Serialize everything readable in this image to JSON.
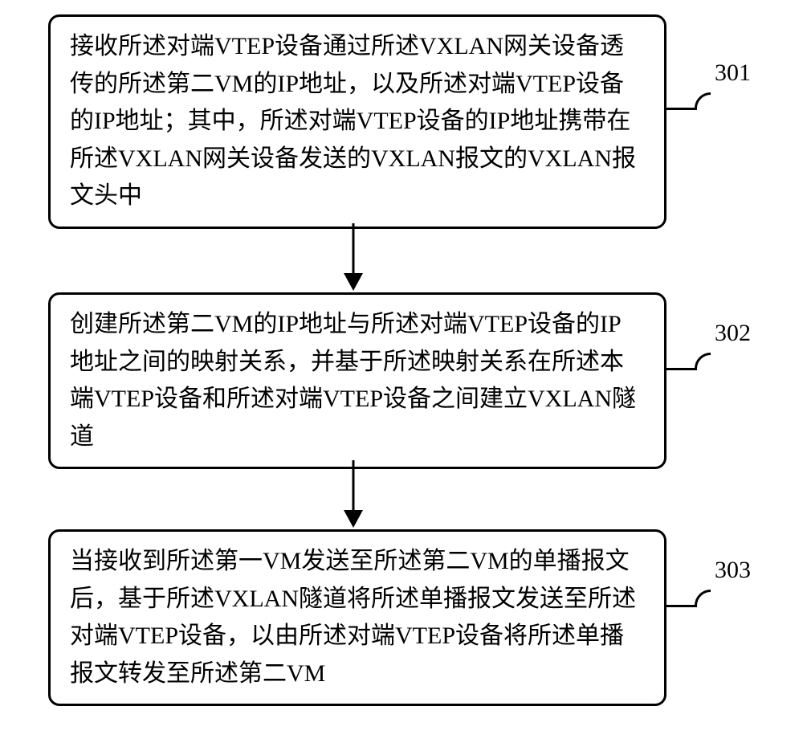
{
  "step1": {
    "text": "接收所述对端VTEP设备通过所述VXLAN网关设备透传的所述第二VM的IP地址，以及所述对端VTEP设备的IP地址；其中，所述对端VTEP设备的IP地址携带在所述VXLAN网关设备发送的VXLAN报文的VXLAN报文头中",
    "ref": "301"
  },
  "step2": {
    "text": "创建所述第二VM的IP地址与所述对端VTEP设备的IP地址之间的映射关系，并基于所述映射关系在所述本端VTEP设备和所述对端VTEP设备之间建立VXLAN隧道",
    "ref": "302"
  },
  "step3": {
    "text": "当接收到所述第一VM发送至所述第二VM的单播报文后，基于所述VXLAN隧道将所述单播报文发送至所述对端VTEP设备，以由所述对端VTEP设备将所述单播报文转发至所述第二VM",
    "ref": "303"
  }
}
